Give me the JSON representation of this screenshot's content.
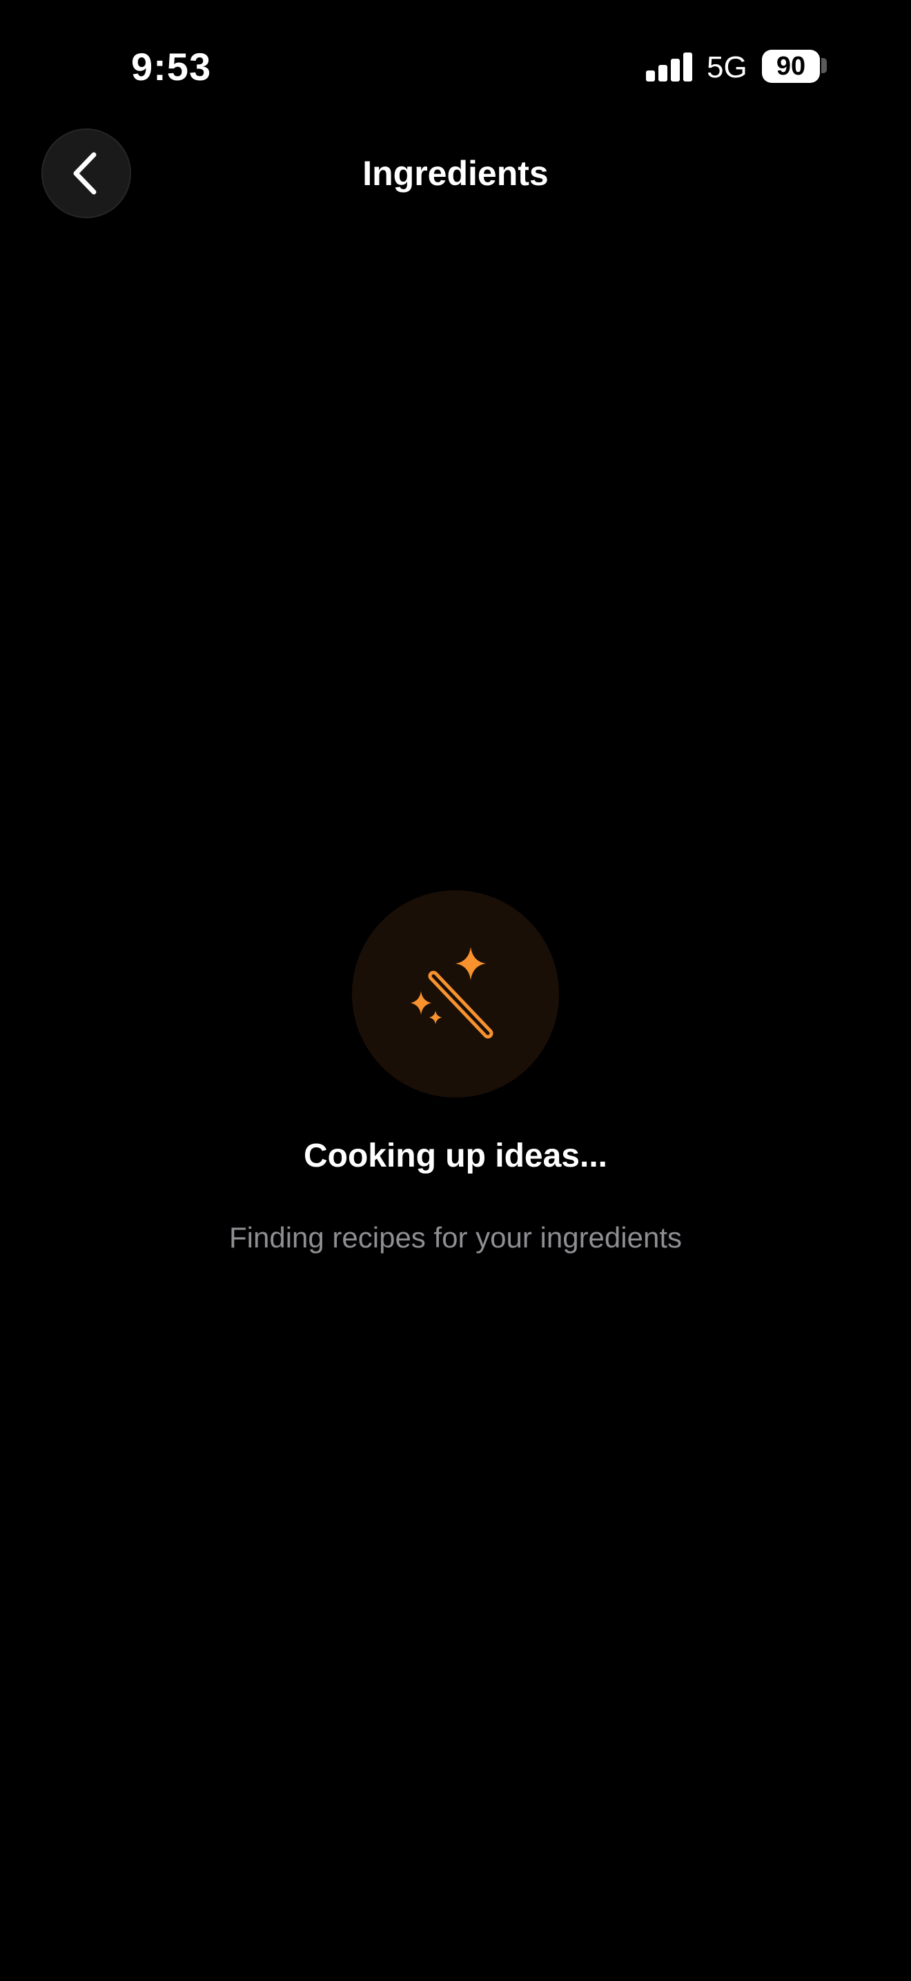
{
  "status_bar": {
    "time": "9:53",
    "network": "5G",
    "battery": "90",
    "icons": [
      "signal-icon",
      "battery-icon"
    ]
  },
  "header": {
    "title": "Ingredients",
    "back_icon": "chevron-left-icon"
  },
  "loading": {
    "icon": "magic-wand-sparkles-icon",
    "title": "Cooking up ideas...",
    "subtitle": "Finding recipes for your ingredients"
  },
  "colors": {
    "background": "#000000",
    "accent": "#F7922E",
    "icon_circle": "#1A0F07",
    "subtitle_text": "#8E8E93",
    "back_button_bg": "#1A1A1A"
  }
}
